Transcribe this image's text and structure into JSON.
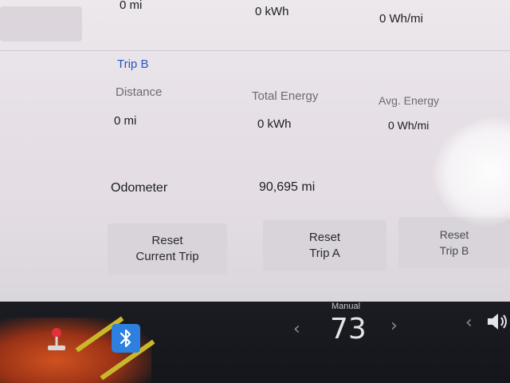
{
  "trip_a": {
    "distance_value": "0 mi",
    "total_energy_value": "0 kWh",
    "avg_energy_value": "0 Wh/mi"
  },
  "trip_b": {
    "title": "Trip B",
    "distance_label": "Distance",
    "total_energy_label": "Total Energy",
    "avg_energy_label": "Avg. Energy",
    "distance_value": "0 mi",
    "total_energy_value": "0 kWh",
    "avg_energy_value": "0 Wh/mi"
  },
  "odometer": {
    "label": "Odometer",
    "value": "90,695 mi"
  },
  "buttons": {
    "reset_current_trip": [
      "Reset",
      "Current Trip"
    ],
    "reset_trip_a": [
      "Reset",
      "Trip A"
    ],
    "reset_trip_b": [
      "Reset",
      "Trip B"
    ]
  },
  "taskbar": {
    "climate_mode": "Manual",
    "temperature": "73",
    "left_chevron": "‹",
    "right_chevron": "›",
    "icons": [
      "joystick-icon",
      "bluetooth-icon",
      "volume-icon"
    ]
  },
  "colors": {
    "section_title": "#2456c6",
    "bluetooth": "#2d7fe0",
    "taskbar": "#16181d"
  }
}
